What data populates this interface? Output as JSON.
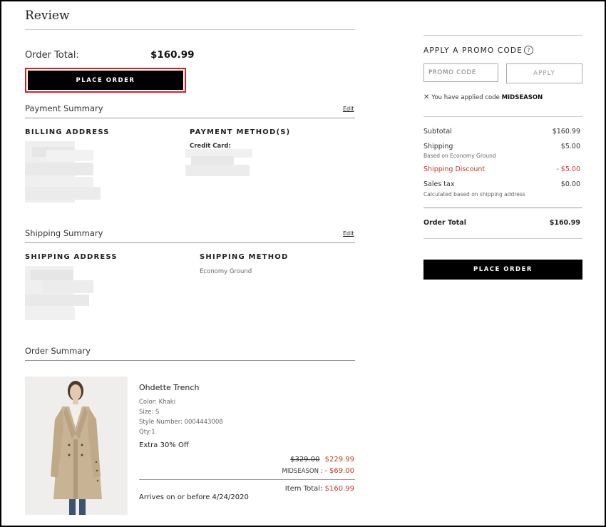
{
  "review": {
    "title": "Review",
    "order_total_label": "Order Total:",
    "order_total_value": "$160.99",
    "place_order_label": "PLACE ORDER",
    "payment_summary": {
      "title": "Payment Summary",
      "edit": "Edit",
      "billing_address_label": "BILLING ADDRESS",
      "payment_method_label": "PAYMENT METHOD(S)",
      "credit_card_label": "Credit Card:"
    },
    "shipping_summary": {
      "title": "Shipping Summary",
      "edit": "Edit",
      "shipping_address_label": "SHIPPING ADDRESS",
      "shipping_method_label": "SHIPPING METHOD",
      "shipping_method_value": "Economy Ground"
    },
    "order_summary": {
      "title": "Order Summary",
      "item": {
        "name": "Ohdette Trench",
        "color": "Color: Khaki",
        "size": "Size: S",
        "style": "Style Number: 0004443008",
        "qty": "Qty:1",
        "promo_text": "Extra 30% Off",
        "original_price": "$329.00",
        "sale_price": "$229.99",
        "discount_label": "MIDSEASON : ",
        "discount_value": "- $69.00",
        "item_total_label": "Item Total: ",
        "item_total_value": "$160.99",
        "arrival": "Arrives on or before 4/24/2020"
      }
    }
  },
  "sidebar": {
    "promo_title": "APPLY A PROMO CODE",
    "help_icon": "?",
    "promo_placeholder": "PROMO CODE",
    "apply_label": "APPLY",
    "applied_prefix": "You have applied code ",
    "applied_code": "MIDSEASON",
    "summary": {
      "subtotal_label": "Subtotal",
      "subtotal_value": "$160.99",
      "shipping_label": "Shipping",
      "shipping_sub": "Based on Economy Ground",
      "shipping_value": "$5.00",
      "discount_label": "Shipping Discount",
      "discount_value": "- $5.00",
      "tax_label": "Sales tax",
      "tax_sub": "Calculated based on shipping address",
      "tax_value": "$0.00",
      "total_label": "Order Total",
      "total_value": "$160.99"
    },
    "place_order_label": "PLACE ORDER"
  },
  "colors": {
    "accent_red": "#c0392b",
    "highlight_border": "#e01b24",
    "button_bg": "#000000"
  }
}
